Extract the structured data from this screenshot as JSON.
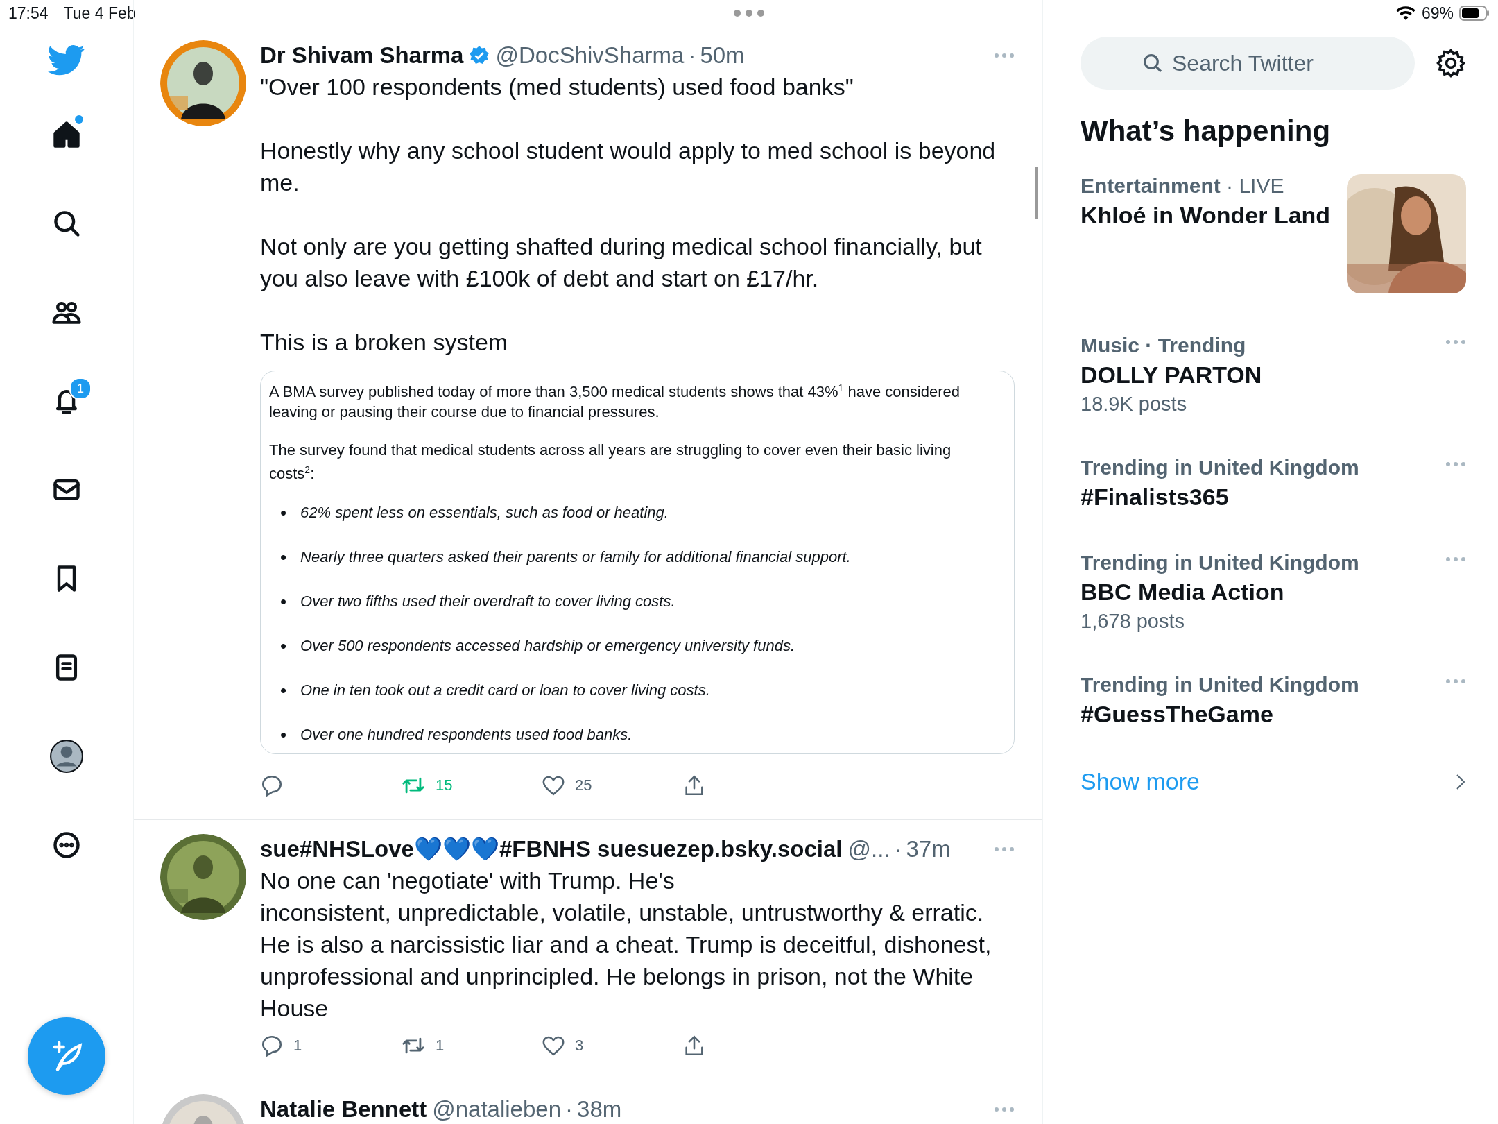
{
  "status_bar": {
    "time": "17:54",
    "date": "Tue 4 Feb",
    "battery": "69%"
  },
  "sidebar": {
    "items": [
      {
        "kind": "home",
        "dot": true
      },
      {
        "kind": "search"
      },
      {
        "kind": "communities"
      },
      {
        "kind": "notifications",
        "badge": "1"
      },
      {
        "kind": "messages"
      },
      {
        "kind": "bookmarks"
      },
      {
        "kind": "lists"
      },
      {
        "kind": "profile"
      },
      {
        "kind": "more"
      }
    ]
  },
  "tweets": [
    {
      "name": "Dr Shivam Sharma",
      "verified": true,
      "handle": "@DocShivSharma",
      "separator": "·",
      "time": "50m",
      "paragraphs": [
        "\"Over 100 respondents (med students) used food banks\"",
        "Honestly why any school student would apply to med school is beyond me.",
        "Not only are you getting shafted during medical school financially, but you also leave with £100k of debt and start on £17/hr.",
        "This is a broken system"
      ],
      "document": {
        "paragraphs": [
          "A BMA survey published today of more than 3,500 medical students shows that 43%$^{1}$ have considered leaving or pausing their course due to financial pressures.",
          "The survey found that medical students across all years are struggling to cover even their basic living costs$^{2}$:"
        ],
        "bullets": [
          {
            "marker": "•",
            "text": "62% spent less on essentials, such as food or heating."
          },
          {
            "marker": "•",
            "text": "Nearly three quarters asked their parents or family for additional financial support."
          },
          {
            "marker": "•",
            "text": "Over two fifths used their overdraft to cover living costs."
          },
          {
            "marker": "•",
            "text": "Over 500 respondents accessed hardship or emergency university funds."
          },
          {
            "marker": "•",
            "text": "One in ten took out a credit card or loan to cover living costs."
          },
          {
            "marker": "•",
            "text": "Over one hundred respondents used food banks."
          }
        ]
      },
      "retweets": "15",
      "retweeted": true,
      "likes": "25",
      "liked": false
    },
    {
      "name": "sue#NHSLove💙💙💙#FBNHS suesuezep.bsky.social",
      "handle": "@...",
      "separator": "·",
      "time": "37m",
      "paragraphs": [
        "No one can 'negotiate' with Trump. He's\ninconsistent, unpredictable, volatile, unstable, untrustworthy & erratic. He is also a narcissistic liar and a cheat. Trump is deceitful, dishonest, unprofessional and unprincipled. He belongs in prison, not the White House"
      ],
      "replies": "1",
      "retweets": "1",
      "retweeted": false,
      "likes": "3",
      "liked": false
    },
    {
      "name": "Natalie Bennett",
      "handle": "@natalieben",
      "separator": "·",
      "time": "38m"
    }
  ],
  "search": {
    "placeholder": "Search Twitter"
  },
  "trends_title": "What’s happening",
  "trends": [
    {
      "category": "Entertainment",
      "separator": "·",
      "context": "LIVE",
      "topic": "Khloé in Wonder Land",
      "kind": "picture"
    },
    {
      "category": "Music · Trending",
      "topic": "DOLLY PARTON",
      "count": "18.9K posts",
      "kind": "more"
    },
    {
      "category": "Trending in United Kingdom",
      "topic": "#Finalists365",
      "kind": "more"
    },
    {
      "category": "Trending in United Kingdom",
      "topic": "BBC Media Action",
      "count": "1,678 posts",
      "kind": "more"
    },
    {
      "category": "Trending in United Kingdom",
      "topic": "#GuessTheGame",
      "kind": "more"
    }
  ],
  "show_more": "Show more"
}
